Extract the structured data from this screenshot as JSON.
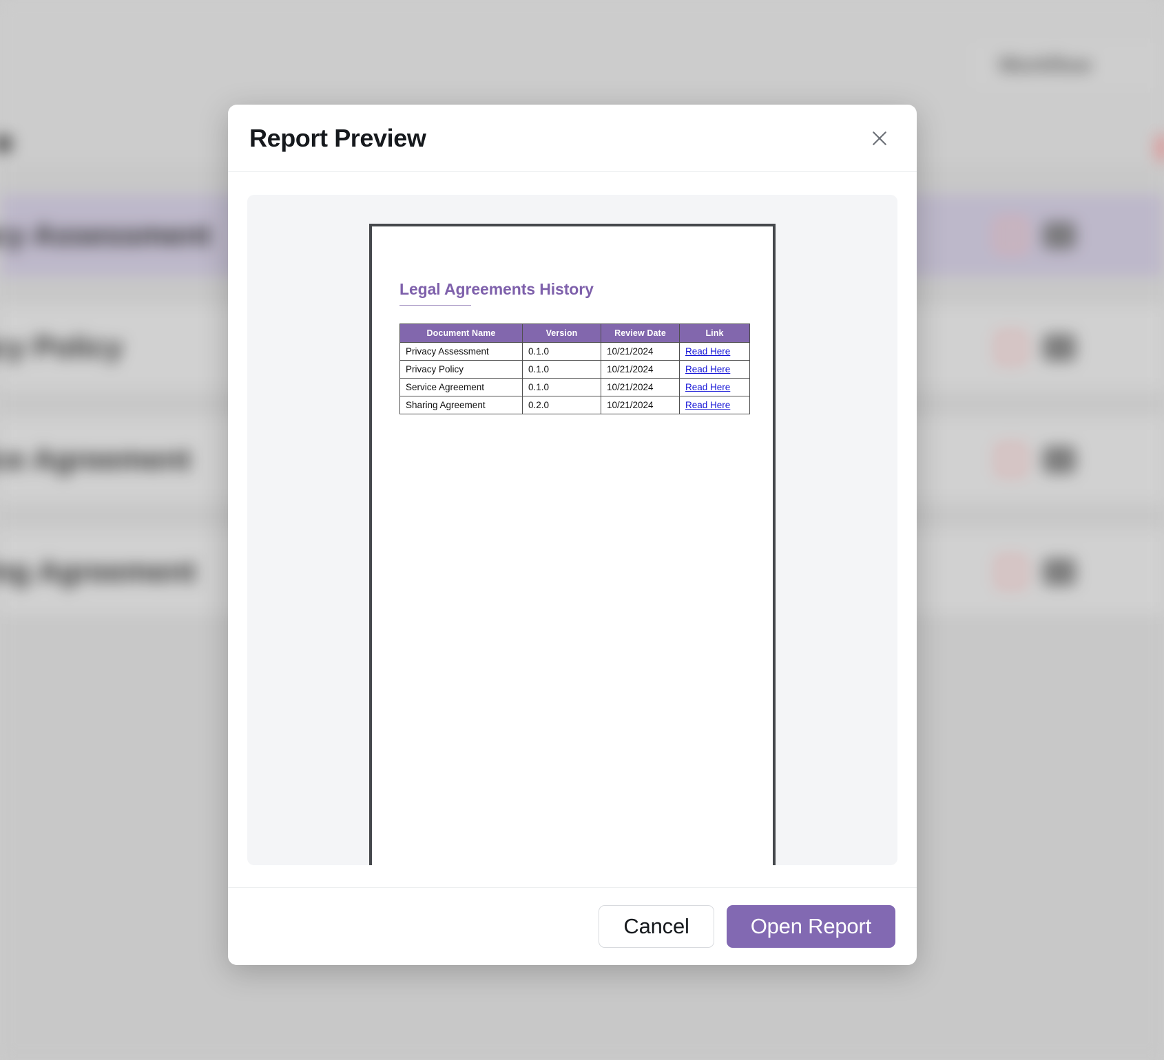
{
  "background": {
    "topbar_button_label": "Workflow",
    "rows": [
      {
        "name": "Privacy Assessment",
        "selected": true,
        "delete_icon": "trash-icon",
        "download_icon": "download-icon"
      },
      {
        "name": "Privacy Policy",
        "selected": false,
        "delete_icon": "trash-icon",
        "download_icon": "download-icon"
      },
      {
        "name": "Service Agreement",
        "selected": false,
        "delete_icon": "trash-icon",
        "download_icon": "download-icon"
      },
      {
        "name": "Sharing Agreement",
        "selected": false,
        "delete_icon": "trash-icon",
        "download_icon": "download-icon"
      }
    ]
  },
  "modal": {
    "title": "Report Preview",
    "close_icon": "close-icon",
    "report": {
      "heading": "Legal Agreements History",
      "columns": [
        "Document Name",
        "Version",
        "Review Date",
        "Link"
      ],
      "rows": [
        {
          "document_name": "Privacy Assessment",
          "version": "0.1.0",
          "review_date": "10/21/2024",
          "link_label": "Read Here"
        },
        {
          "document_name": "Privacy Policy",
          "version": "0.1.0",
          "review_date": "10/21/2024",
          "link_label": "Read Here"
        },
        {
          "document_name": "Service Agreement",
          "version": "0.1.0",
          "review_date": "10/21/2024",
          "link_label": "Read Here"
        },
        {
          "document_name": "Sharing Agreement",
          "version": "0.2.0",
          "review_date": "10/21/2024",
          "link_label": "Read Here"
        }
      ]
    },
    "footer": {
      "cancel_label": "Cancel",
      "open_report_label": "Open Report"
    }
  },
  "colors": {
    "accent_purple": "#8269b2",
    "table_header_purple": "#8267ad",
    "heading_purple": "#7e60ab",
    "link_blue": "#1414d6",
    "page_border": "#45484c",
    "preview_surface": "#f4f5f7",
    "selected_row": "#c6c0d4",
    "delete_icon": "#e9aeae"
  }
}
